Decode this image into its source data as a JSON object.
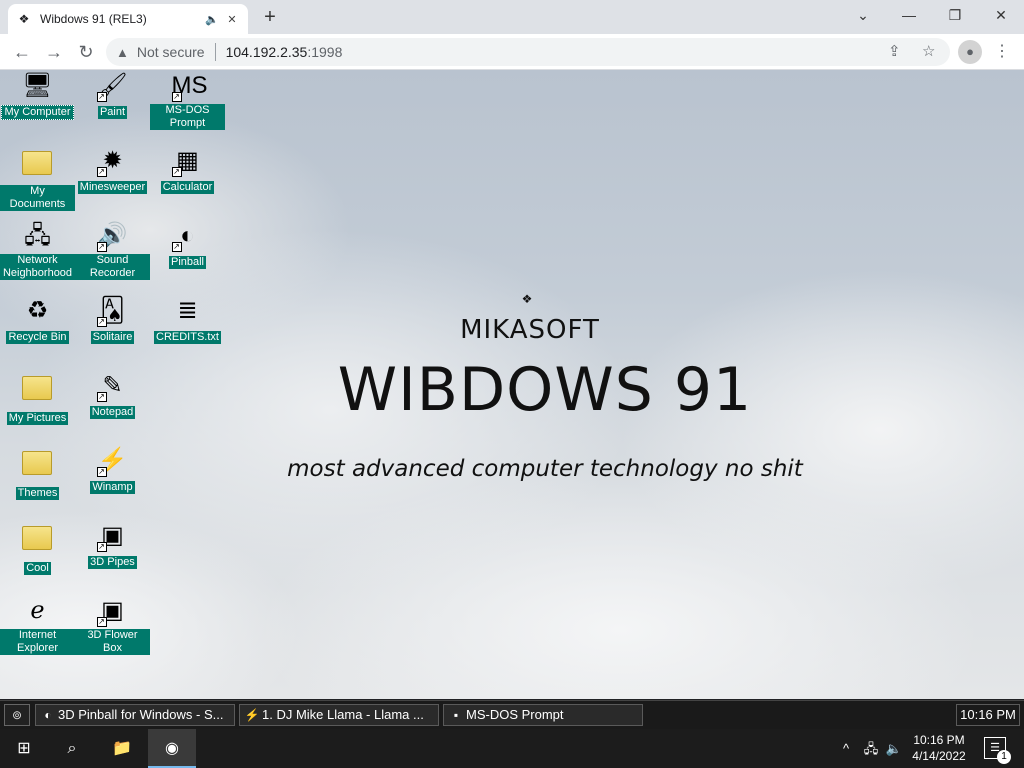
{
  "browser": {
    "tab": {
      "title": "Wibdows 91 (REL3)",
      "favicon": "wibdows-flag-icon",
      "audio_icon": "speaker-icon",
      "close_icon": "close-icon"
    },
    "new_tab": "+",
    "window_controls": {
      "collapse": "⌄",
      "minimize": "—",
      "maximize": "❐",
      "close": "✕"
    },
    "nav": {
      "back": "←",
      "forward": "→",
      "reload": "↻"
    },
    "omnibox": {
      "security_icon": "▲",
      "security_text": "Not secure",
      "host": "104.192.2.35",
      "port": ":1998"
    },
    "actions": {
      "share": "⇪",
      "bookmark": "☆",
      "profile": "●",
      "menu": "⋮"
    }
  },
  "desktop": {
    "icons": [
      {
        "label": "My Computer",
        "icon": "computer-icon",
        "glyph": "🖥",
        "selected": true,
        "shortcut": false
      },
      {
        "label": "Paint",
        "icon": "paint-icon",
        "glyph": "🖌",
        "shortcut": true
      },
      {
        "label": "MS-DOS Prompt",
        "icon": "msdos-icon",
        "glyph": "MS",
        "shortcut": true
      },
      {
        "label": "My Documents",
        "icon": "documents-folder-icon",
        "glyph": "📂",
        "shortcut": false
      },
      {
        "label": "Minesweeper",
        "icon": "mine-icon",
        "glyph": "✹",
        "shortcut": true
      },
      {
        "label": "Calculator",
        "icon": "calculator-icon",
        "glyph": "▦",
        "shortcut": true
      },
      {
        "label": "Network Neighborhood",
        "icon": "network-icon",
        "glyph": "🖧",
        "shortcut": false
      },
      {
        "label": "Sound Recorder",
        "icon": "sound-recorder-icon",
        "glyph": "🔊",
        "shortcut": true
      },
      {
        "label": "Pinball",
        "icon": "pinball-icon",
        "glyph": "◐",
        "shortcut": true
      },
      {
        "label": "Recycle Bin",
        "icon": "recycle-bin-icon",
        "glyph": "♻",
        "shortcut": false
      },
      {
        "label": "Solitaire",
        "icon": "solitaire-icon",
        "glyph": "🂡",
        "shortcut": true
      },
      {
        "label": "CREDITS.txt",
        "icon": "text-file-icon",
        "glyph": "≣",
        "shortcut": false
      },
      {
        "label": "My Pictures",
        "icon": "folder-icon",
        "glyph": "",
        "shortcut": false
      },
      {
        "label": "Notepad",
        "icon": "notepad-icon",
        "glyph": "✎",
        "shortcut": true
      },
      {
        "label": "Themes",
        "icon": "folder-icon",
        "glyph": "",
        "shortcut": false
      },
      {
        "label": "Winamp",
        "icon": "winamp-icon",
        "glyph": "⚡",
        "shortcut": true
      },
      {
        "label": "Cool",
        "icon": "folder-icon",
        "glyph": "",
        "shortcut": false
      },
      {
        "label": "3D Pipes",
        "icon": "screensaver-icon",
        "glyph": "▣",
        "shortcut": true
      },
      {
        "label": "Internet Explorer",
        "icon": "internet-explorer-icon",
        "glyph": "ℯ",
        "shortcut": false
      },
      {
        "label": "3D Flower Box",
        "icon": "screensaver-icon",
        "glyph": "▣",
        "shortcut": true
      }
    ],
    "brand": {
      "logo": "❖",
      "company": "MIKASOFT",
      "product": "WIBDOWS 91",
      "tagline": "most advanced computer technology no shit"
    }
  },
  "w9x_taskbar": {
    "start_glyph": "⊚",
    "buttons": [
      {
        "label": "3D Pinball for Windows - S...",
        "icon": "pinball-icon",
        "glyph": "◐"
      },
      {
        "label": "1. DJ Mike Llama - Llama ...",
        "icon": "winamp-icon",
        "glyph": "⚡"
      },
      {
        "label": "MS-DOS Prompt",
        "icon": "msdos-icon",
        "glyph": "▪"
      }
    ],
    "clock": "10:16 PM"
  },
  "win_taskbar": {
    "start": "⊞",
    "search": "⌕",
    "explorer": "📁",
    "chrome": "◉",
    "tray": {
      "chevron": "^",
      "network": "🖧",
      "volume": "🔈"
    },
    "time": "10:16 PM",
    "date": "4/14/2022",
    "notifications": "☰",
    "notification_count": "1"
  }
}
